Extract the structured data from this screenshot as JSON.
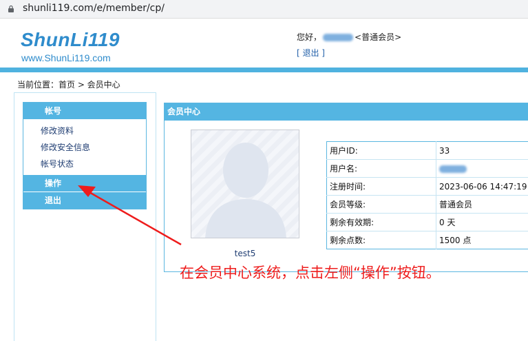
{
  "browser": {
    "url": "shunli119.com/e/member/cp/",
    "lock_icon": "lock-icon"
  },
  "header": {
    "logo_text": "ShunLi119",
    "logo_sub": "www.ShunLi119.com",
    "greeting_prefix": "您好，",
    "greeting_suffix": "<普通会员>",
    "logout_link": "[ 退出 ]"
  },
  "breadcrumb": "当前位置：首页 > 会员中心",
  "sidebar": {
    "account_header": "帐号",
    "items": [
      "修改资料",
      "修改安全信息",
      "帐号状态"
    ],
    "operate_header": "操作",
    "logout_header": "退出"
  },
  "panel": {
    "title": "会员中心",
    "avatar_name": "test5",
    "info": [
      {
        "key": "用户ID:",
        "value": "33"
      },
      {
        "key": "用户名:",
        "value": ""
      },
      {
        "key": "注册时间:",
        "value": "2023-06-06 14:47:19"
      },
      {
        "key": "会员等级:",
        "value": "普通会员"
      },
      {
        "key": "剩余有效期:",
        "value": "0 天"
      },
      {
        "key": "剩余点数:",
        "value": "1500 点"
      }
    ]
  },
  "annotation": {
    "text": "在会员中心系统，点击左侧“操作”按钮。",
    "color": "#ee1c1c"
  },
  "colors": {
    "accent": "#54b5e2",
    "logo": "#2f8ccc"
  }
}
